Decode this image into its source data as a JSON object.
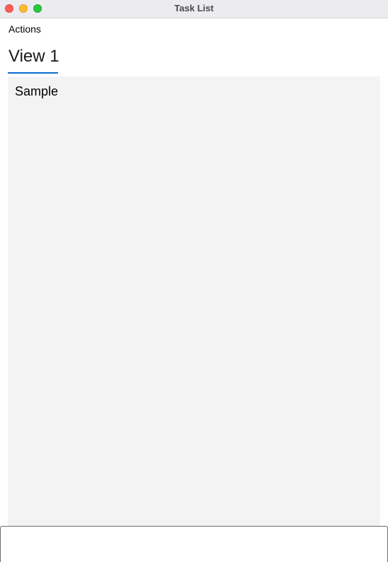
{
  "window": {
    "title": "Task List"
  },
  "menu": {
    "actions_label": "Actions"
  },
  "tabs": [
    {
      "label": "View 1",
      "selected": true
    }
  ],
  "content": {
    "text": "Sample"
  },
  "colors": {
    "tab_indicator": "#0a6ed1",
    "panel_background": "#f3f3f3",
    "titlebar_background": "#ecebf0",
    "close_button": "#fe5f57",
    "minimize_button": "#febc2e",
    "zoom_button": "#28c840"
  }
}
